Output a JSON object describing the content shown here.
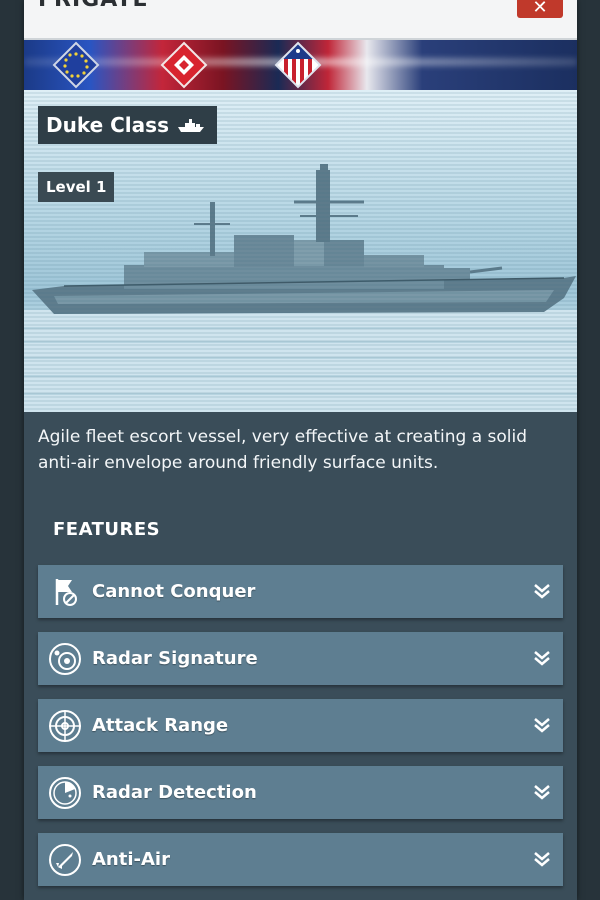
{
  "header": {
    "title": "FRIGATE",
    "close_label": "✕"
  },
  "flags": [
    {
      "name": "eu-flag-icon"
    },
    {
      "name": "red-white-flag-icon"
    },
    {
      "name": "us-flag-icon"
    }
  ],
  "ship": {
    "class_name": "Duke Class",
    "level": "Level 1",
    "description": "Agile fleet escort vessel, very effective at creating a solid anti-air envelope around friendly surface units."
  },
  "features": {
    "heading": "FEATURES",
    "items": [
      {
        "label": "Cannot Conquer",
        "icon": "no-conquer-flag-icon"
      },
      {
        "label": "Radar Signature",
        "icon": "radar-signature-icon"
      },
      {
        "label": "Attack Range",
        "icon": "crosshair-icon"
      },
      {
        "label": "Radar Detection",
        "icon": "radar-detection-icon"
      },
      {
        "label": "Anti-Air",
        "icon": "anti-air-missile-icon"
      }
    ]
  },
  "colors": {
    "panel": "#3a4d59",
    "feature_row": "#5e7e91",
    "close_button": "#c0392b",
    "header": "#f4f5f6"
  }
}
